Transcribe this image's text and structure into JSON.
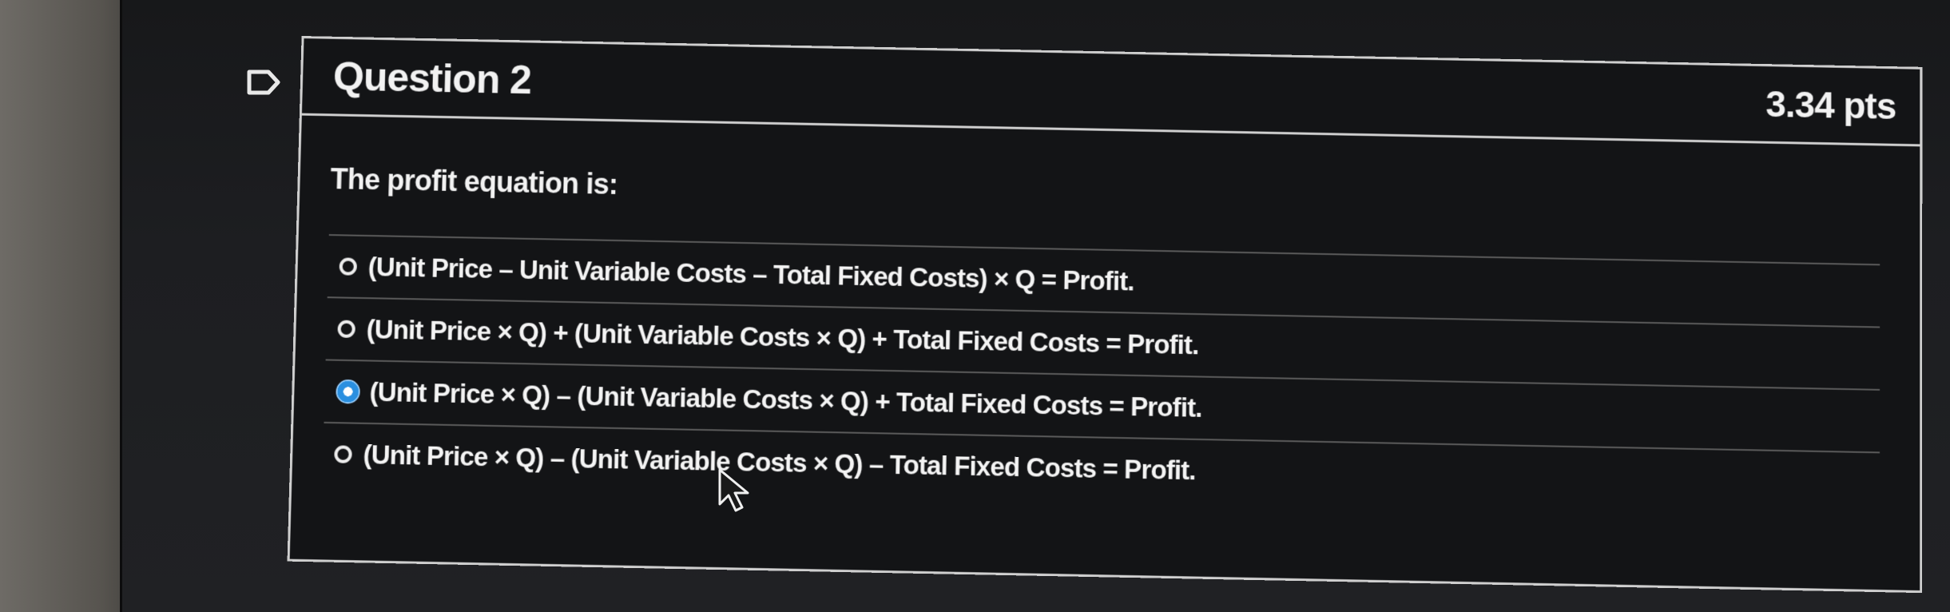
{
  "question": {
    "title": "Question 2",
    "points": "3.34 pts",
    "prompt": "The profit equation is:",
    "answers": [
      {
        "label": "(Unit Price – Unit Variable Costs – Total Fixed Costs) × Q = Profit.",
        "selected": false
      },
      {
        "label": "(Unit Price × Q) + (Unit Variable Costs × Q) + Total Fixed Costs = Profit.",
        "selected": false
      },
      {
        "label": "(Unit Price × Q) – (Unit Variable Costs × Q) + Total Fixed Costs = Profit.",
        "selected": true
      },
      {
        "label": "(Unit Price × Q) – (Unit Variable Costs × Q) – Total Fixed Costs = Profit.",
        "selected": false
      }
    ]
  },
  "colors": {
    "selected_radio": "#2a8fe0",
    "card_border": "#cfcfcf",
    "background": "#131416"
  },
  "icons": {
    "flag": "flag-question-icon",
    "cursor": "mouse-pointer-icon"
  }
}
